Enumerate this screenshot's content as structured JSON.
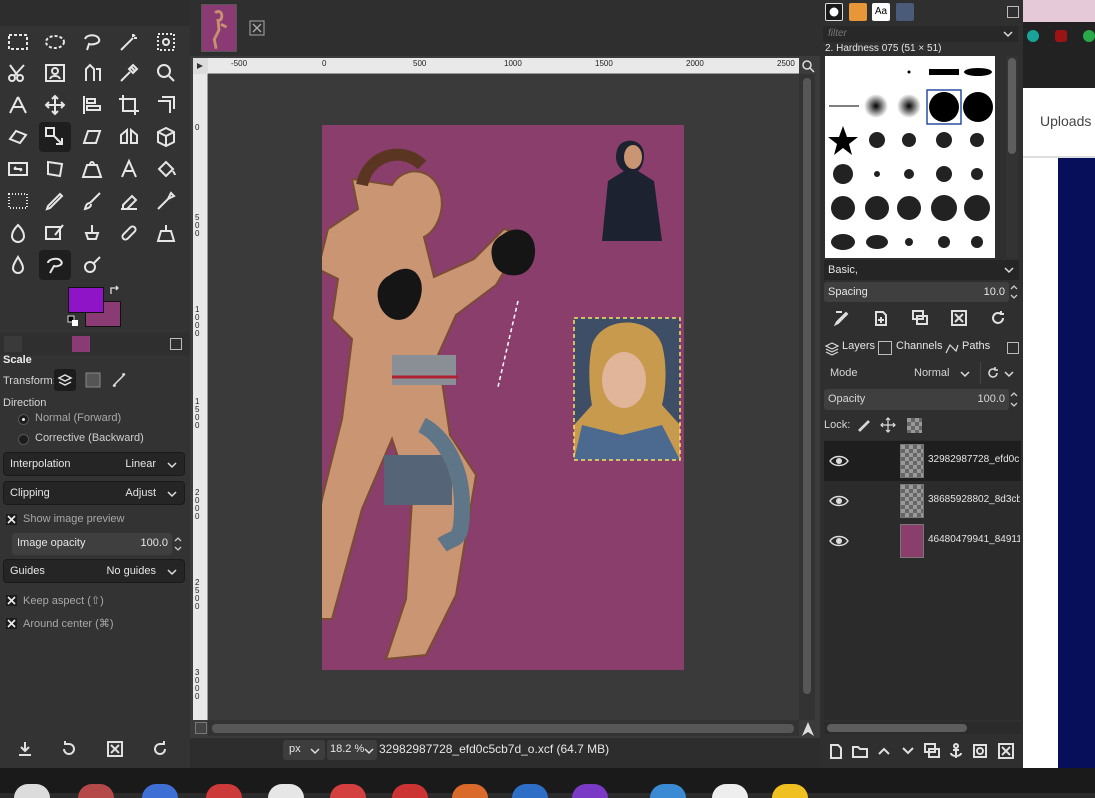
{
  "toolbox": {
    "tools": [
      "rect-select",
      "ellipse-select",
      "free-select",
      "fuzzy-select",
      "select-by-color",
      "scissors-select",
      "foreground-select",
      "paths",
      "color-picker",
      "zoom",
      "measure",
      "move",
      "align",
      "crop",
      "unified-transform",
      "rotate",
      "scale",
      "shear",
      "flip",
      "3d-transform",
      "warp",
      "cage",
      "perspective",
      "text",
      "bucket-fill",
      "gradient",
      "pencil",
      "paintbrush",
      "eraser",
      "airbrush",
      "ink",
      "mypaint-brush",
      "clone",
      "heal",
      "perspective-clone",
      "blur",
      "smudge",
      "dodge-burn"
    ],
    "colors": {
      "foreground": "#8f14c8",
      "background": "#8b3b73"
    }
  },
  "tool_options": {
    "title": "Scale",
    "transform_label": "Transform:",
    "direction_label": "Direction",
    "direction_normal": "Normal (Forward)",
    "direction_corrective": "Corrective (Backward)",
    "interpolation_label": "Interpolation",
    "interpolation_value": "Linear",
    "clipping_label": "Clipping",
    "clipping_value": "Adjust",
    "show_preview": "Show image preview",
    "image_opacity_label": "Image opacity",
    "image_opacity_value": "100.0",
    "guides_label": "Guides",
    "guides_value": "No guides",
    "keep_aspect": "Keep aspect (⇧)",
    "around_center": "Around center (⌘)"
  },
  "ruler": {
    "top_ticks": [
      "-500",
      "0",
      "500",
      "1000",
      "1500",
      "2000",
      "2500"
    ],
    "left_ticks": [
      "0",
      "5 0 0",
      "1 0 0 0",
      "1 5 0 0",
      "2 0 0 0",
      "2 5 0 0",
      "3 0 0 0",
      "3 5 0 0"
    ]
  },
  "statusbar": {
    "unit": "px",
    "zoom": "18.2 %",
    "file": "32982987728_efd0c5cb7d_o.xcf (64.7 MB)"
  },
  "brushes": {
    "filter_placeholder": "filter",
    "selected_name": "2. Hardness 075 (51 × 51)",
    "tag": "Basic,",
    "spacing_label": "Spacing",
    "spacing_value": "10.0"
  },
  "layers_panel": {
    "tabs": [
      "Layers",
      "Channels",
      "Paths"
    ],
    "mode_label": "Mode",
    "mode_value": "Normal",
    "opacity_label": "Opacity",
    "opacity_value": "100.0",
    "lock_label": "Lock:",
    "layers": [
      {
        "name": "32982987728_efd0c",
        "selected": true
      },
      {
        "name": "38685928802_8d3cb",
        "selected": false
      },
      {
        "name": "46480479941_84911",
        "selected": false
      }
    ]
  },
  "browser": {
    "uploads": "Uploads"
  }
}
